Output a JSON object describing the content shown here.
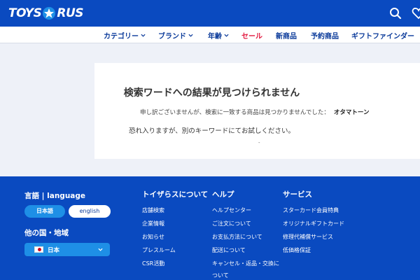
{
  "header": {
    "logo_text": "TOYS",
    "logo_text_2": "US",
    "icons": [
      "search-icon",
      "heart-icon"
    ]
  },
  "nav": {
    "items": [
      {
        "label": "カテゴリー",
        "has_chevron": true
      },
      {
        "label": "ブランド",
        "has_chevron": true
      },
      {
        "label": "年齢",
        "has_chevron": true
      },
      {
        "label": "セール",
        "has_chevron": false
      },
      {
        "label": "新商品",
        "has_chevron": false
      },
      {
        "label": "予約商品",
        "has_chevron": false
      },
      {
        "label": "ギフトファインダー",
        "has_chevron": false
      }
    ],
    "sale_color": "#e2183f",
    "link_color": "#0a3a9a"
  },
  "result": {
    "title": "検索ワードへの結果が見つけられません",
    "message": "申し訳ございませんが、検索に一致する商品は見つかりませんでした：",
    "keyword": "オタマトーン",
    "suggestion": "恐れ入りますが、別のキーワードにてお試しください。",
    "dot": "-"
  },
  "footer": {
    "language_heading": "言語 | language",
    "lang_jp": "日本語",
    "lang_en": "english",
    "country_heading": "他の国・地域",
    "country_value": "日本",
    "columns": [
      {
        "heading": "トイザらスについて",
        "links": [
          "店舗検索",
          "企業情報",
          "お知らせ",
          "プレスルーム",
          "CSR活動"
        ]
      },
      {
        "heading": "ヘルプ",
        "links": [
          "ヘルプセンター",
          "ご注文について",
          "お支払方法について",
          "配送について",
          "キャンセル・返品・交換に",
          "ついて"
        ]
      },
      {
        "heading": "サービス",
        "links": [
          "スターカード会員特典",
          "オリジナルギフトカード",
          "修理代補償サービス",
          "低価格保証"
        ]
      }
    ]
  },
  "colors": {
    "brand_blue": "#0a4ac0",
    "accent_blue": "#1e8fe6",
    "background": "#eef1f8"
  }
}
